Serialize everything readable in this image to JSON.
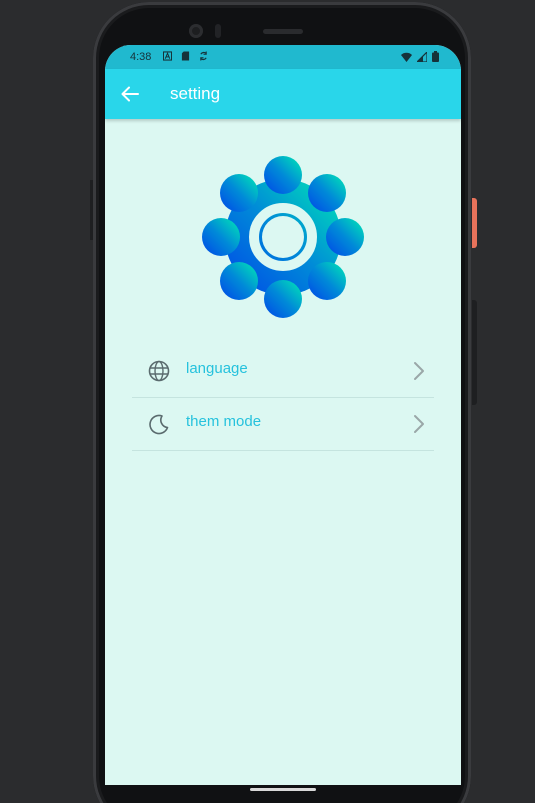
{
  "status_bar": {
    "time": "4:38",
    "icons_left": [
      "a-icon",
      "sd-card-icon",
      "sync-icon"
    ],
    "icons_right": [
      "wifi-icon",
      "signal-icon",
      "battery-icon"
    ]
  },
  "app_bar": {
    "title": "setting",
    "back_icon": "arrow-left-icon",
    "color": "#29d6ea"
  },
  "hero": {
    "icon": "gear-icon",
    "gradient": [
      "#0050e6",
      "#00e6b8"
    ]
  },
  "settings": {
    "items": [
      {
        "label": "language",
        "icon": "globe-icon"
      },
      {
        "label": "them mode",
        "icon": "moon-icon"
      }
    ]
  },
  "colors": {
    "background": "#dcf8f2",
    "accent_text": "#26c2dd"
  }
}
